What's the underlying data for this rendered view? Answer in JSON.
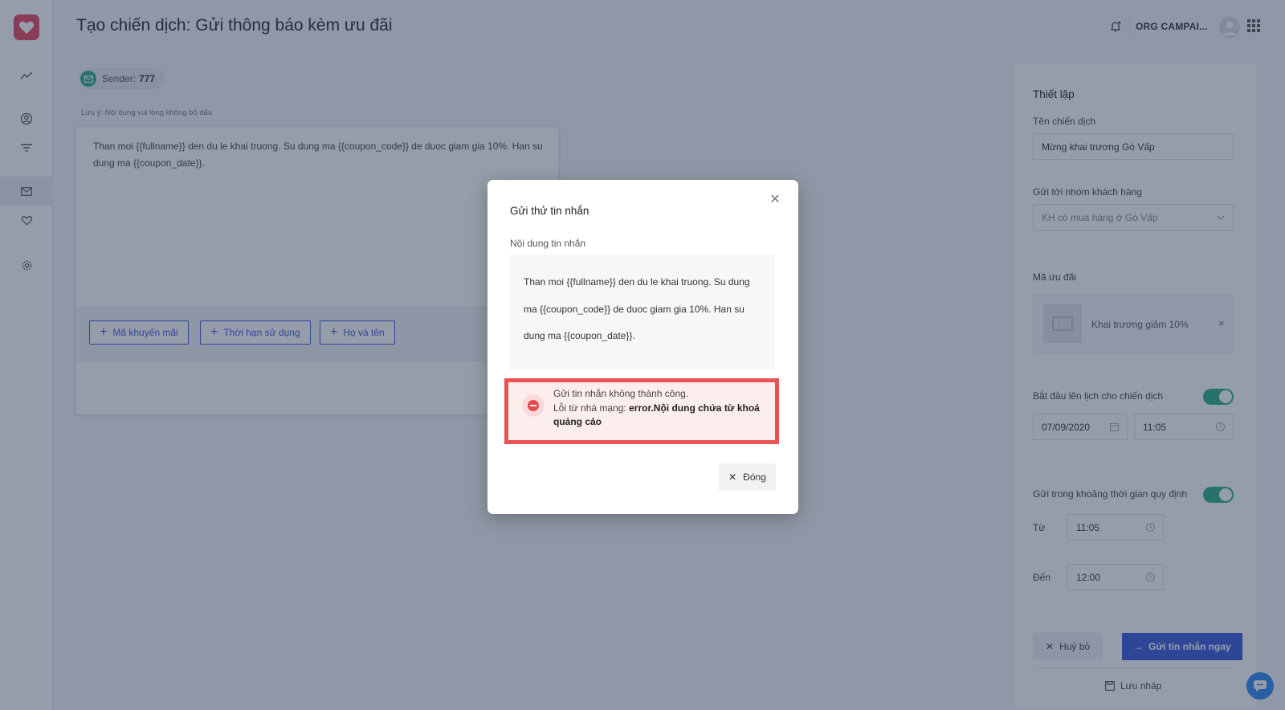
{
  "header": {
    "title": "Tạo chiến dịch: Gửi thông báo kèm ưu đãi",
    "org_name": "ORG CAMPAI..."
  },
  "sender": {
    "label": "Sender:",
    "value": "777"
  },
  "note": "Lưu ý: Nội dung vui lòng không bỏ dấu",
  "editor": {
    "text": "Than moi {{fullname}} den du le khai truong. Su dung ma {{coupon_code}} de duoc giam gia 10%. Han su dung ma {{coupon_date}}.",
    "buttons": {
      "coupon_code": "Mã khuyến mãi",
      "expiry": "Thời hạn sử dụng",
      "fullname": "Họ và tên"
    }
  },
  "panel": {
    "title": "Thiết lập",
    "campaign_name_label": "Tên chiến dịch",
    "campaign_name_value": "Mừng khai trương Gò  Vấp",
    "group_label": "Gửi tới nhóm khách hàng",
    "group_value": "KH có mua hàng ở Gò Vấp",
    "coupon_label": "Mã ưu đãi",
    "coupon_value": "Khai trương giảm 10%",
    "schedule_label": "Bắt đầu lên lịch cho chiến dịch",
    "schedule_date": "07/09/2020",
    "schedule_time": "11:05",
    "window_label": "Gửi trong khoảng thời gian quy định",
    "from_label": "Từ",
    "from_value": "11:05",
    "to_label": "Đến",
    "to_value": "12:00",
    "cancel_label": "Huỷ bỏ",
    "send_label": "Gửi tin nhắn ngay",
    "draft_label": "Lưu nháp",
    "schedule_enabled": true,
    "window_enabled": true
  },
  "modal": {
    "title": "Gửi thử tin nhắn",
    "content_label": "Nội dung tin nhắn",
    "message_text": "Than moi {{fullname}} den du le khai truong. Su dung ma {{coupon_code}} de duoc giam gia 10%. Han su dung ma {{coupon_date}}.",
    "error_title": "Gửi tin nhắn không thành công.",
    "error_prefix": "Lỗi từ nhà mạng:",
    "error_detail": "error.Nội dung chứa từ khoá quảng cáo",
    "close_label": "Đóng"
  },
  "colors": {
    "brand": "#e8475f",
    "primary": "#3b5bdb",
    "success": "#2eaf88",
    "error": "#e95353"
  }
}
